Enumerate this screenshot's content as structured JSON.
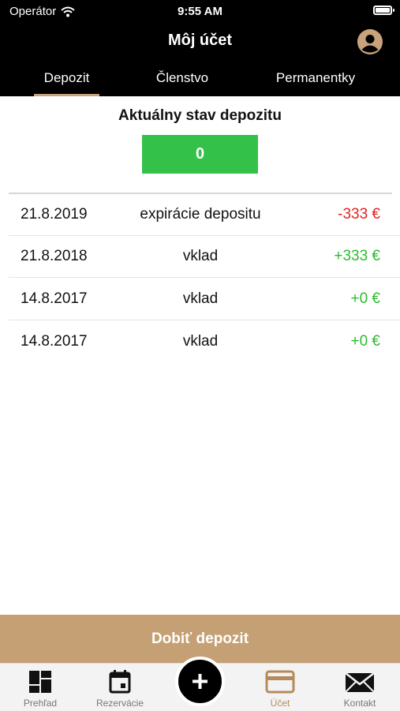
{
  "status_bar": {
    "carrier": "Operátor",
    "time": "9:55 AM"
  },
  "header": {
    "title": "Môj účet",
    "profile_icon": "user-circle-icon"
  },
  "tabs": [
    {
      "label": "Depozit",
      "active": true
    },
    {
      "label": "Členstvo",
      "active": false
    },
    {
      "label": "Permanentky",
      "active": false
    }
  ],
  "deposit": {
    "title": "Aktuálny stav depozitu",
    "balance": "0",
    "balance_color": "#33c14a"
  },
  "transactions": [
    {
      "date": "21.8.2019",
      "description": "expirácie depositu",
      "amount": "-333 €",
      "type": "negative"
    },
    {
      "date": "21.8.2018",
      "description": "vklad",
      "amount": "+333 €",
      "type": "positive"
    },
    {
      "date": "14.8.2017",
      "description": "vklad",
      "amount": "+0 €",
      "type": "positive"
    },
    {
      "date": "14.8.2017",
      "description": "vklad",
      "amount": "+0 €",
      "type": "positive"
    }
  ],
  "colors": {
    "negative": "#e3231f",
    "positive": "#2dbb2d",
    "accent": "#c4a074"
  },
  "topup_button": {
    "label": "Dobiť depozit"
  },
  "bottom_nav": [
    {
      "label": "Prehľad",
      "icon": "dashboard-icon",
      "active": false
    },
    {
      "label": "Rezervácie",
      "icon": "calendar-icon",
      "active": false
    },
    {
      "label": "",
      "icon": "plus-icon",
      "active": false
    },
    {
      "label": "Účet",
      "icon": "card-icon",
      "active": true
    },
    {
      "label": "Kontakt",
      "icon": "mail-icon",
      "active": false
    }
  ]
}
